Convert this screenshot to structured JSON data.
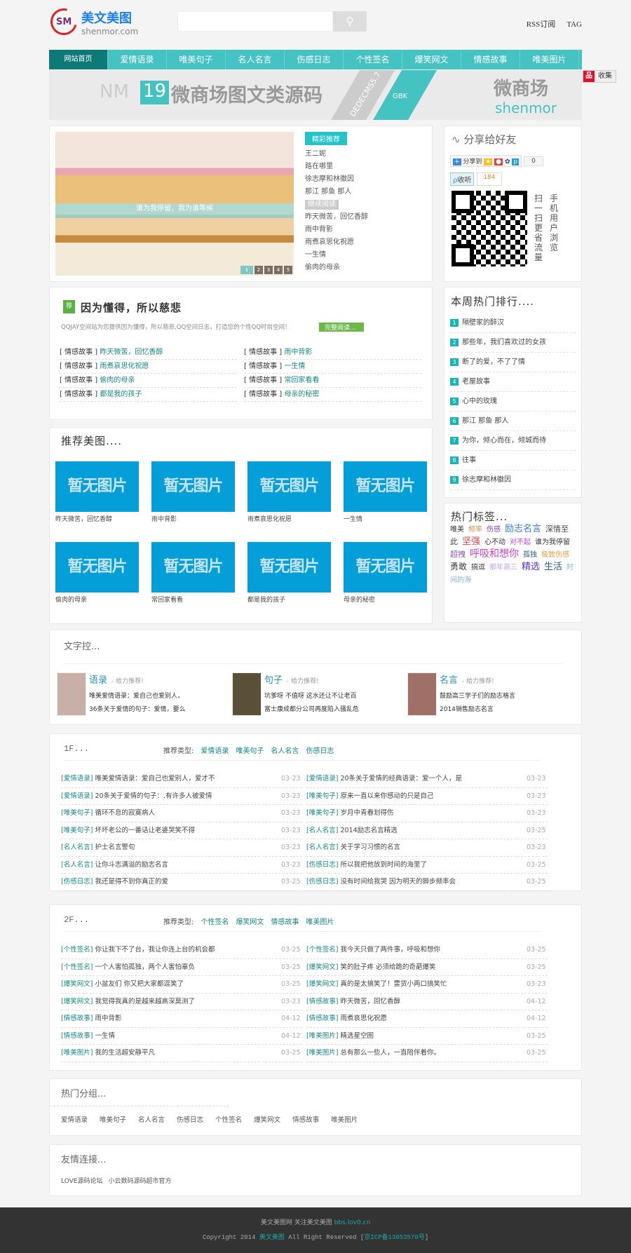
{
  "header": {
    "logo_cn": "美文美图",
    "logo_en": "shenmor.com",
    "logo_mark": "SM",
    "search_placeholder": "",
    "search_icon": "search-icon",
    "rss": "RSS订阅",
    "tag": "TAG"
  },
  "nav": [
    "网站首页",
    "爱情语录",
    "唯美句子",
    "名人名言",
    "伤感日志",
    "个性签名",
    "爆笑网文",
    "情感故事",
    "唯美图片"
  ],
  "banner": {
    "nm": "NM",
    "num": "19",
    "title": "微商场图文类源码",
    "dede": "DEDECMS5.7",
    "gbk": "GBK",
    "brand_cn": "微商场",
    "brand_en": "shenmor"
  },
  "fav": {
    "icon": "品",
    "label": "收集"
  },
  "slider": {
    "caption": "谁为我停留，我为谁等候",
    "dots": [
      "1",
      "2",
      "3",
      "4",
      "5"
    ]
  },
  "picks": {
    "badge": "精彩推荐",
    "items": [
      "王二妮",
      "路在哪里",
      "徐志摩和林徽因",
      "那江 那鱼 那人"
    ],
    "more": "继续阅读",
    "items2": [
      "昨天微苦，回忆香醇",
      "雨中背影",
      "雨煮哀思化祝愿",
      "一生情",
      "偷肉的母亲"
    ]
  },
  "share": {
    "title": "分享给好友",
    "share_to": "分享到",
    "count": "0",
    "listen": "收听",
    "listen_count": "184",
    "qr_text1": "扫一扫更省流量",
    "qr_text2": "手机用户浏览"
  },
  "featured": {
    "icon": "荐",
    "title": "因为懂得，所以慈悲",
    "desc": "QQJAY空间站为您提供因为懂得，所以慈悲,QQ空间日志，打造您的个性QQ时尚空间！",
    "read": "完整阅读...",
    "items": [
      {
        "cat": "[ 情感故事 ]",
        "t": "昨天微苦，回忆香醇"
      },
      {
        "cat": "[ 情感故事 ]",
        "t": "雨中背影"
      },
      {
        "cat": "[ 情感故事 ]",
        "t": "雨煮哀思化祝愿"
      },
      {
        "cat": "[ 情感故事 ]",
        "t": "一生情"
      },
      {
        "cat": "[ 情感故事 ]",
        "t": "偷肉的母亲"
      },
      {
        "cat": "[ 情感故事 ]",
        "t": "常回家看看"
      },
      {
        "cat": "[ 情感故事 ]",
        "t": "都是我的孩子"
      },
      {
        "cat": "[ 情感故事 ]",
        "t": "母亲的秘密"
      }
    ]
  },
  "ranking": {
    "title": "本周热门排行....",
    "items": [
      "隔壁家的醉汉",
      "那些年，我们喜欢过的女孩",
      "断了的爱，不了了情",
      "老屋故事",
      "心中的玫瑰",
      "那江 那鱼 那人",
      "为你，倾心而在，倾城而待",
      "往事",
      "徐志摩和林徽因"
    ]
  },
  "tags": {
    "title": "热门标签...",
    "items": [
      {
        "t": "唯美",
        "c": "#333",
        "s": 10
      },
      {
        "t": "频率",
        "c": "#c8965a",
        "s": 10
      },
      {
        "t": "伤感",
        "c": "#8a3fb0",
        "s": 10
      },
      {
        "t": "励志名言",
        "c": "#3a7ae0",
        "s": 13
      },
      {
        "t": "深情至此",
        "c": "#444",
        "s": 11
      },
      {
        "t": "坚强",
        "c": "#e04848",
        "s": 13
      },
      {
        "t": "心不动",
        "c": "#333",
        "s": 10
      },
      {
        "t": "对不起",
        "c": "#c040e0",
        "s": 10
      },
      {
        "t": "谁为我停留",
        "c": "#333",
        "s": 10
      },
      {
        "t": "超拽",
        "c": "#8a5ab0",
        "s": 11
      },
      {
        "t": "呼吸和想你",
        "c": "#d040d0",
        "s": 14
      },
      {
        "t": "孤独",
        "c": "#2a6080",
        "s": 10
      },
      {
        "t": "极致伤感",
        "c": "#e0a040",
        "s": 10
      },
      {
        "t": "勇敢",
        "c": "#444",
        "s": 12
      },
      {
        "t": "搞逗",
        "c": "#333",
        "s": 10
      },
      {
        "t": "那年高三",
        "c": "#c8a0e8",
        "s": 10
      },
      {
        "t": "精选",
        "c": "#5a30c8",
        "s": 13
      },
      {
        "t": "生活",
        "c": "#2a5a8a",
        "s": 13
      },
      {
        "t": "时间的海",
        "c": "#80b8d8",
        "s": 10
      }
    ]
  },
  "pics": {
    "title": "推荐美图....",
    "placeholder": "暂无图片",
    "items": [
      "昨天微苦，回忆香醇",
      "雨中背影",
      "雨煮哀思化祝愿",
      "一生情",
      "偷肉的母亲",
      "常回家看看",
      "都是我的孩子",
      "母亲的秘密"
    ]
  },
  "wenzi": {
    "title": "文字控...",
    "items": [
      {
        "t": "语录",
        "sub": "- 给力推荐!",
        "l1": "唯美爱情语录：爱自己也爱别人，",
        "l2": "36条关于爱情的句子：爱情，要么",
        "bg": "#c8b0a8"
      },
      {
        "t": "句子",
        "sub": "- 给力推荐!",
        "l1": "坑爹呀 不值呀 这水还让不让老百",
        "l2": "富士康成都分公司再度陷入骚乱危",
        "bg": "#5a5038"
      },
      {
        "t": "名言",
        "sub": "- 给力推荐!",
        "l1": "鼓励高三学子们的励志格言",
        "l2": "2014销售励志名言",
        "bg": "#a07068"
      }
    ]
  },
  "floors": [
    {
      "title": "1F...",
      "types_label": "推荐类型:",
      "types": [
        "爱情语录",
        "唯美句子",
        "名人名言",
        "伤感日志"
      ],
      "rows": [
        {
          "cat": "[爱情语录]",
          "t": "唯美爱情语录：爱自己也爱别人，爱才不",
          "d": "03-23"
        },
        {
          "cat": "[爱情语录]",
          "t": "20条关于爱情的经典语录：爱一个人，是",
          "d": "03-23"
        },
        {
          "cat": "[爱情语录]",
          "t": "20条关于爱情的句子：.有许多人被爱情",
          "d": "03-23"
        },
        {
          "cat": "[唯美句子]",
          "t": "原来一直以来你感动的只是自己",
          "d": "03-23"
        },
        {
          "cat": "[唯美句子]",
          "t": "循环不息的寂寞病人",
          "d": "03-23"
        },
        {
          "cat": "[唯美句子]",
          "t": "岁月中青春划得伤",
          "d": "03-23"
        },
        {
          "cat": "[唯美句子]",
          "t": "坏坏老公的一番话让老婆哭笑不得",
          "d": "03-23"
        },
        {
          "cat": "[名人名言]",
          "t": "2014励志名言精选",
          "d": "03-25"
        },
        {
          "cat": "[名人名言]",
          "t": "护士名言警句",
          "d": "03-23"
        },
        {
          "cat": "[名人名言]",
          "t": "关于学习习惯的名言",
          "d": "03-23"
        },
        {
          "cat": "[名人名言]",
          "t": "让你斗志满溢的励志名言",
          "d": "03-23"
        },
        {
          "cat": "[伤感日志]",
          "t": "所以我把他放到时间的海里了",
          "d": "03-25"
        },
        {
          "cat": "[伤感日志]",
          "t": "我还是得不到你真正的爱",
          "d": "03-25"
        },
        {
          "cat": "[伤感日志]",
          "t": "没有时间给我哭 因为明天的脚步频率会",
          "d": "03-25"
        }
      ]
    },
    {
      "title": "2F...",
      "types_label": "推荐类型:",
      "types": [
        "个性签名",
        "爆笑网文",
        "情感故事",
        "唯美图片"
      ],
      "rows": [
        {
          "cat": "[个性签名]",
          "t": "你让我下不了台，我让你连上台的机会都",
          "d": "03-25"
        },
        {
          "cat": "[个性签名]",
          "t": "我今天只做了两件事，呼吸和想你",
          "d": "03-25"
        },
        {
          "cat": "[个性签名]",
          "t": "一个人害怕孤独，两个人害怕辜负",
          "d": "03-25"
        },
        {
          "cat": "[爆笑网文]",
          "t": "笑的肚子疼 必须给跪的奇葩爆笑",
          "d": "03-25"
        },
        {
          "cat": "[爆笑网文]",
          "t": "小盆友们 你又把大家都逗笑了",
          "d": "03-25"
        },
        {
          "cat": "[爆笑网文]",
          "t": "真的是太搞笑了！雷货小两口搞笑忙",
          "d": "03-23"
        },
        {
          "cat": "[爆笑网文]",
          "t": "我觉得我真的是越来越高深莫测了",
          "d": "03-23"
        },
        {
          "cat": "[情感故事]",
          "t": "昨天微苦，回忆香醇",
          "d": "04-12"
        },
        {
          "cat": "[情感故事]",
          "t": "雨中背影",
          "d": "04-12"
        },
        {
          "cat": "[情感故事]",
          "t": "雨煮哀思化祝愿",
          "d": "04-12"
        },
        {
          "cat": "[情感故事]",
          "t": "一生情",
          "d": "04-12"
        },
        {
          "cat": "[唯美图片]",
          "t": "精选星空图",
          "d": "03-25"
        },
        {
          "cat": "[唯美图片]",
          "t": "我的生活超安静平凡",
          "d": "03-25"
        },
        {
          "cat": "[唯美图片]",
          "t": "总有那么一些人，一直陪伴着你。",
          "d": "03-25"
        }
      ]
    }
  ],
  "groups": {
    "title": "热门分组...",
    "items": [
      "爱情语录",
      "唯美句子",
      "名人名言",
      "伤感日志",
      "个性签名",
      "爆笑网文",
      "情感故事",
      "唯美图片"
    ]
  },
  "links": {
    "title": "友情连接...",
    "items": [
      "LOVE源码论坛",
      "小云数码源码超市官方"
    ]
  },
  "footer": {
    "l1a": "美文美图网 关注美文美图",
    "l1b": "bbs.lov0.cn",
    "l2a": "Copyright 2014",
    "l2b": "美文美图",
    "l2c": "All Right Reserved [",
    "l2d": "京ICP备13053570号",
    "l2e": "]"
  }
}
